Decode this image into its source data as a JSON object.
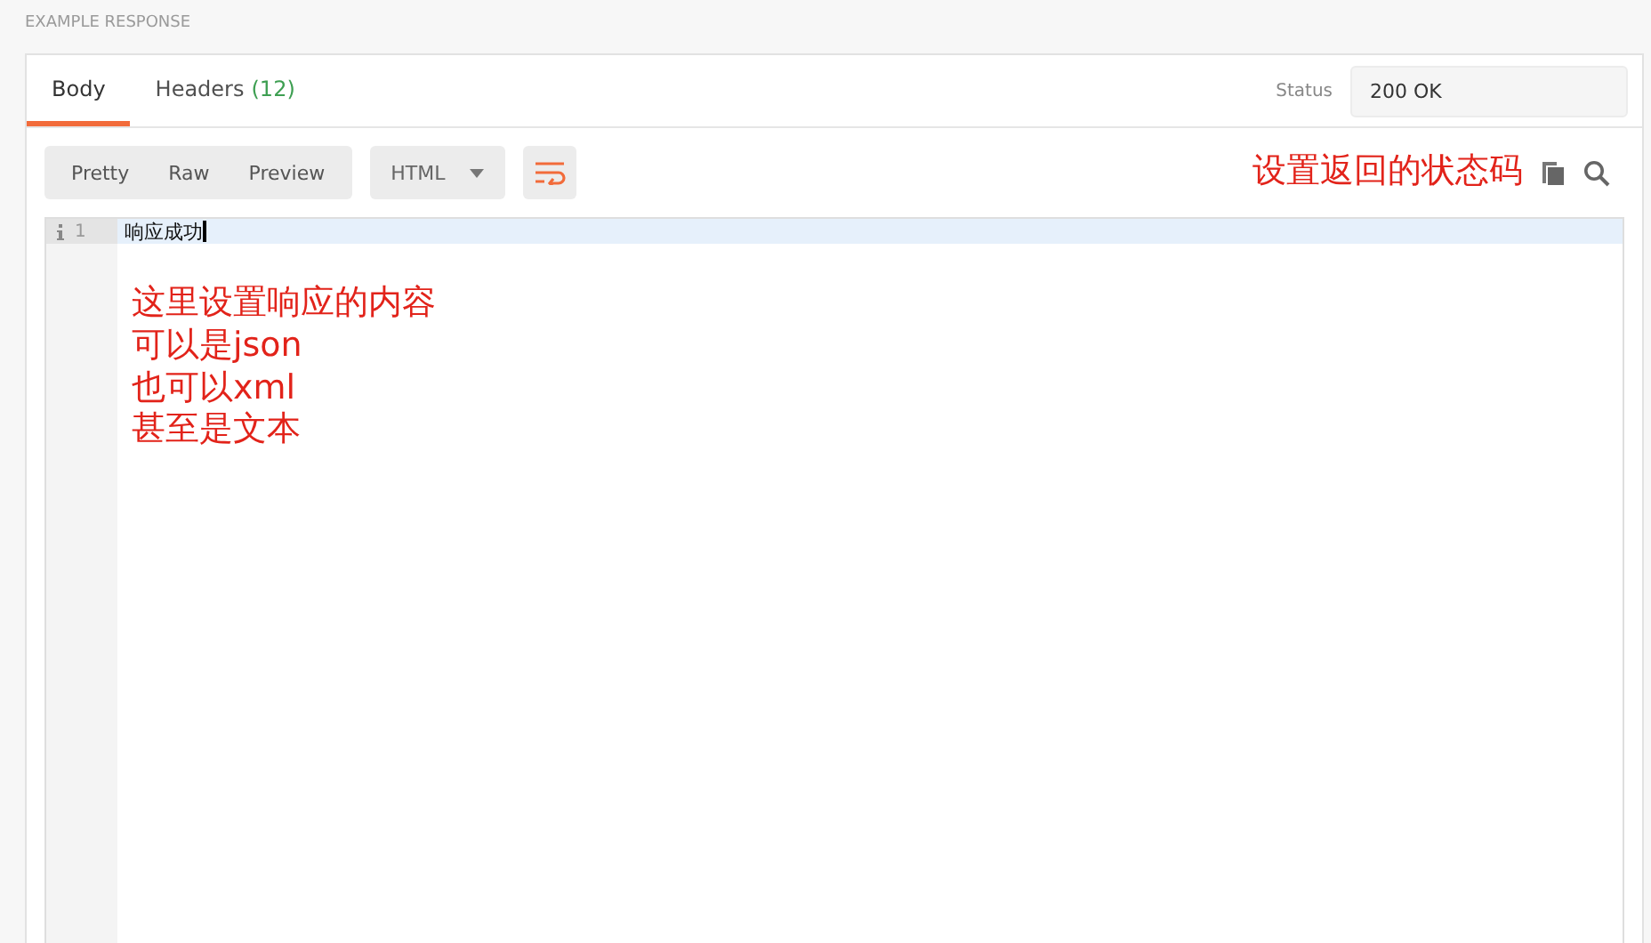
{
  "section_label": "EXAMPLE RESPONSE",
  "tabs": [
    {
      "label": "Body",
      "selected": true
    },
    {
      "label": "Headers",
      "count": "(12)",
      "selected": false
    }
  ],
  "status": {
    "label": "Status",
    "value": "200 OK"
  },
  "format_buttons": [
    "Pretty",
    "Raw",
    "Preview"
  ],
  "language": "HTML",
  "status_note": "设置返回的状态码",
  "editor": {
    "lines": [
      {
        "number": "1",
        "text": "响应成功",
        "current": true
      }
    ]
  },
  "body_note": [
    "这里设置响应的内容",
    "可以是json",
    "也可以xml",
    "甚至是文本"
  ]
}
